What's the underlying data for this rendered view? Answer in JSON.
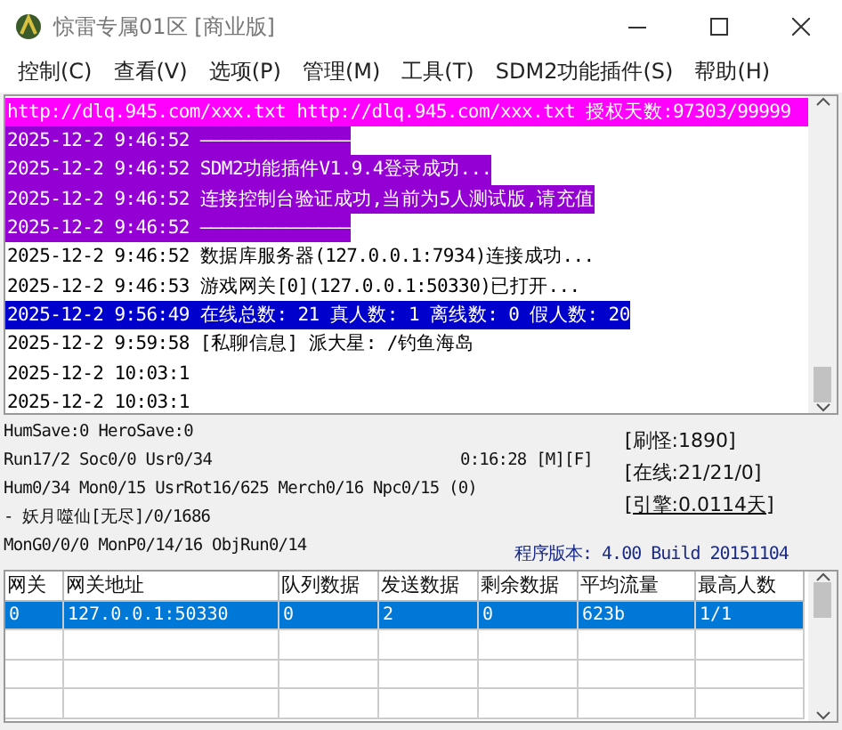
{
  "window": {
    "title": "惊雷专属01区 [商业版]"
  },
  "menu": [
    "控制(C)",
    "查看(V)",
    "选项(P)",
    "管理(M)",
    "工具(T)",
    "SDM2功能插件(S)",
    "帮助(H)"
  ],
  "log": {
    "lines": [
      {
        "text": "http://dlq.945.com/xxx.txt http://dlq.945.com/xxx.txt 授权天数:97303/99999",
        "kind": "license",
        "selected": false
      },
      {
        "text": "2025-12-2 9:46:52 ——————————————",
        "kind": "notice",
        "selected": false
      },
      {
        "text": "2025-12-2 9:46:52 SDM2功能插件V1.9.4登录成功...",
        "kind": "notice",
        "selected": false
      },
      {
        "text": "2025-12-2 9:46:52 连接控制台验证成功,当前为5人测试版,请充值",
        "kind": "notice",
        "selected": false
      },
      {
        "text": "2025-12-2 9:46:52 ——————————————",
        "kind": "notice",
        "selected": false
      },
      {
        "text": "2025-12-2 9:46:52 数据库服务器(127.0.0.1:7934)连接成功...",
        "kind": "plain",
        "selected": false
      },
      {
        "text": "2025-12-2 9:46:53 游戏网关[0](127.0.0.1:50330)已打开...",
        "kind": "plain",
        "selected": false
      },
      {
        "text": "2025-12-2 9:56:49 在线总数: 21 真人数: 1 离线数: 0 假人数: 20",
        "kind": "plain",
        "selected": true
      },
      {
        "text": "2025-12-2 9:59:58 [私聊信息] 派大星: /钓鱼海岛",
        "kind": "plain",
        "selected": false
      },
      {
        "text": "2025-12-2 10:03:1",
        "kind": "plain",
        "selected": false
      },
      {
        "text": "2025-12-2 10:03:1",
        "kind": "plain",
        "selected": false
      }
    ]
  },
  "status": {
    "left": [
      {
        "text": "HumSave:0 HeroSave:0"
      },
      {
        "text": "Run17/2 Soc0/0 Usr0/34",
        "extra": "0:16:28 [M][F]"
      },
      {
        "text": "Hum0/34 Mon0/15 UsrRot16/625 Merch0/16 Npc0/15 (0)"
      },
      {
        "text": " - 妖月噬仙[无尽]/0/1686"
      },
      {
        "text": "MonG0/0/0 MonP0/14/16 ObjRun0/14"
      }
    ],
    "right": [
      "[刷怪:1890]",
      "[在线:21/21/0]",
      "[引擎:0.0114天]"
    ],
    "version": "程序版本: 4.00 Build 20151104"
  },
  "table": {
    "columns": [
      "网关",
      "网关地址",
      "队列数据",
      "发送数据",
      "剩余数据",
      "平均流量",
      "最高人数"
    ],
    "rows": [
      {
        "cells": [
          "0",
          "127.0.0.1:50330",
          "0",
          "2",
          "0",
          "623b",
          "1/1"
        ],
        "selected": true
      }
    ]
  }
}
